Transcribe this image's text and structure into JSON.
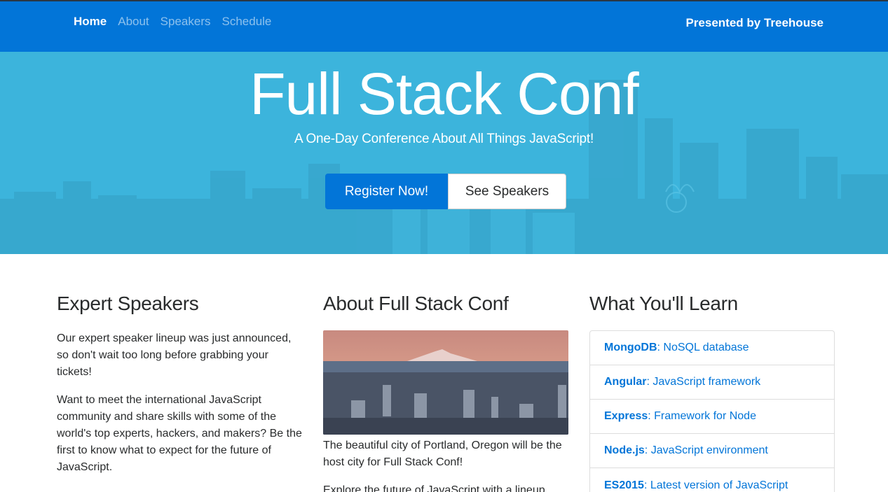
{
  "nav": {
    "links": [
      {
        "label": "Home"
      },
      {
        "label": "About"
      },
      {
        "label": "Speakers"
      },
      {
        "label": "Schedule"
      }
    ],
    "presented_by": "Presented by Treehouse"
  },
  "hero": {
    "title": "Full Stack Conf",
    "subtitle": "A One-Day Conference About All Things JavaScript!",
    "register_label": "Register Now!",
    "speakers_label": "See Speakers"
  },
  "speakers": {
    "heading": "Expert Speakers",
    "p1": "Our expert speaker lineup was just announced, so don't wait too long before grabbing your tickets!",
    "p2": "Want to meet the international JavaScript community and share skills with some of the world's top experts, hackers, and makers? Be the first to know what to expect for the future of JavaScript."
  },
  "about": {
    "heading": "About Full Stack Conf",
    "caption": "The beautiful city of Portland, Oregon will be the host city for Full Stack Conf!",
    "p2": "Explore the future of JavaScript with a lineup"
  },
  "learn": {
    "heading": "What You'll Learn",
    "items": [
      {
        "name": "MongoDB",
        "desc": ": NoSQL database"
      },
      {
        "name": "Angular",
        "desc": ": JavaScript framework"
      },
      {
        "name": "Express",
        "desc": ": Framework for Node"
      },
      {
        "name": "Node.js",
        "desc": ": JavaScript environment"
      },
      {
        "name": "ES2015",
        "desc": ": Latest version of JavaScript"
      }
    ]
  },
  "colors": {
    "brand": "#0275d8",
    "hero_bg": "#3cb4dc"
  }
}
